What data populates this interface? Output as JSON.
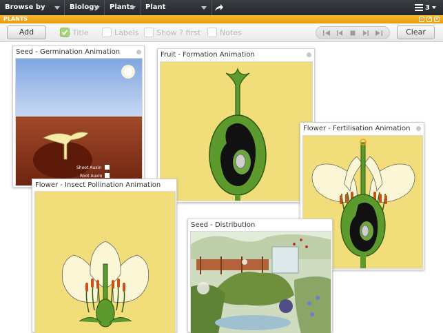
{
  "topbar": {
    "crumbs": [
      "Browse by pack",
      "Biology",
      "Plants",
      "Plant Reproduction"
    ],
    "menu_count": "3"
  },
  "section": {
    "title": "PLANTS"
  },
  "toolbar": {
    "add_label": "Add",
    "clear_label": "Clear",
    "options": [
      {
        "label": "Title",
        "checked": true
      },
      {
        "label": "Labels",
        "checked": false
      },
      {
        "label": "Show ? first",
        "checked": false
      },
      {
        "label": "Notes",
        "checked": false
      }
    ]
  },
  "cards": {
    "germination": {
      "title": "Seed - Germination Animation",
      "legend_shoot": "Shoot Auxin",
      "legend_root": "Root Auxin"
    },
    "fruit": {
      "title": "Fruit - Formation Animation"
    },
    "fertilisation": {
      "title": "Flower - Fertilisation Animation"
    },
    "pollination": {
      "title": "Flower - Insect Pollination Animation"
    },
    "distribution": {
      "title": "Seed - Distribution"
    }
  },
  "colors": {
    "accent": "#f0a31a",
    "plant_green": "#5c9a2e",
    "flower_bg": "#f1dd7a"
  }
}
